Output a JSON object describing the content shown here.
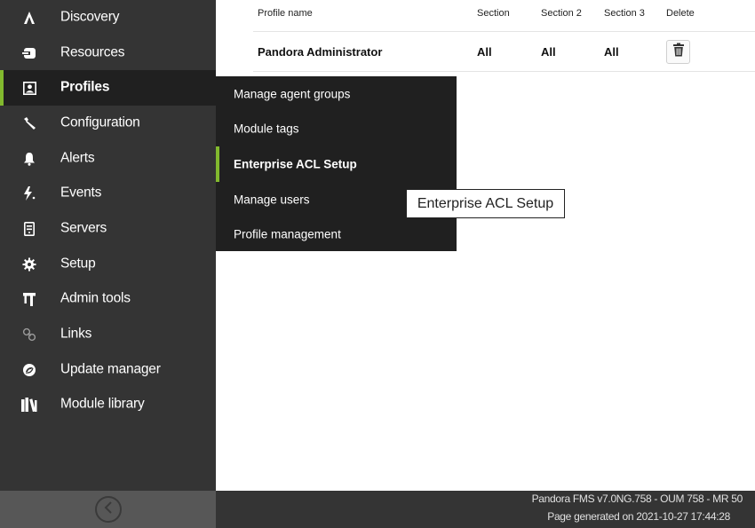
{
  "sidebar": {
    "items": [
      {
        "label": "Discovery",
        "icon": "discovery-icon"
      },
      {
        "label": "Resources",
        "icon": "resources-icon"
      },
      {
        "label": "Profiles",
        "icon": "profile-icon"
      },
      {
        "label": "Configuration",
        "icon": "wrench-icon"
      },
      {
        "label": "Alerts",
        "icon": "bell-icon"
      },
      {
        "label": "Events",
        "icon": "lightning-icon"
      },
      {
        "label": "Servers",
        "icon": "server-icon"
      },
      {
        "label": "Setup",
        "icon": "gear-icon"
      },
      {
        "label": "Admin tools",
        "icon": "admin-tools-icon"
      },
      {
        "label": "Links",
        "icon": "links-icon"
      },
      {
        "label": "Update manager",
        "icon": "update-icon"
      },
      {
        "label": "Module library",
        "icon": "library-icon"
      }
    ],
    "active_index": 2
  },
  "submenu": {
    "items": [
      {
        "label": "Manage agent groups"
      },
      {
        "label": "Module tags"
      },
      {
        "label": "Enterprise ACL Setup"
      },
      {
        "label": "Manage users"
      },
      {
        "label": "Profile management"
      }
    ],
    "active_index": 2
  },
  "tooltip": {
    "text": "Enterprise ACL Setup"
  },
  "table": {
    "headers": [
      "Profile name",
      "Section",
      "Section 2",
      "Section 3",
      "Delete"
    ],
    "rows": [
      {
        "profile_name": "Pandora Administrator",
        "section": "All",
        "section2": "All",
        "section3": "All"
      }
    ]
  },
  "footer": {
    "version": "Pandora FMS v7.0NG.758 - OUM 758 - MR 50",
    "generated": "Page generated on 2021-10-27 17:44:28"
  },
  "colors": {
    "sidebar_bg": "#343434",
    "active_bg": "#202020",
    "accent": "#82b92e",
    "footer_bg": "#343434",
    "collapse_bg": "#575757"
  }
}
